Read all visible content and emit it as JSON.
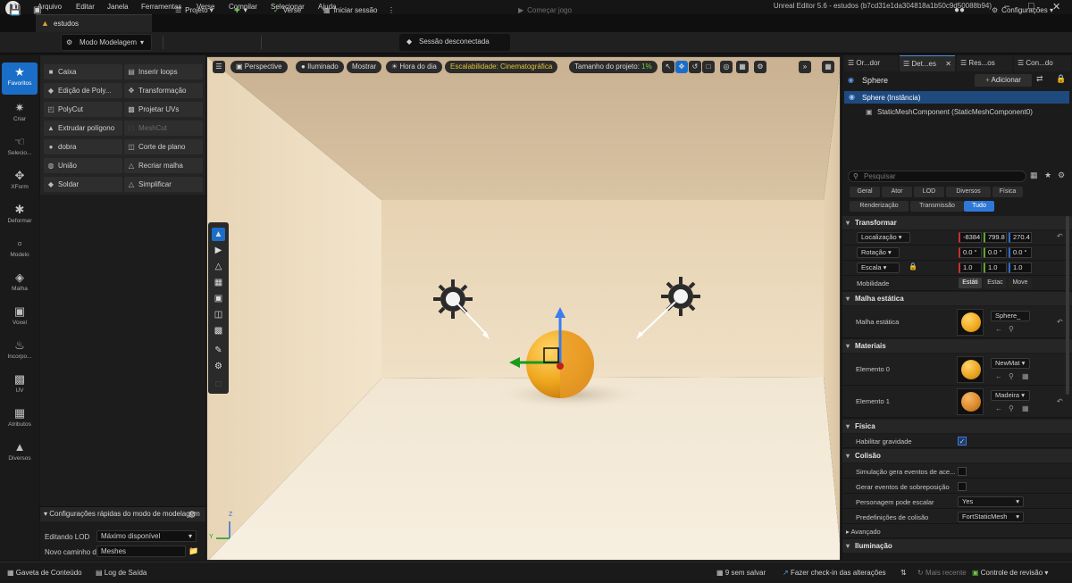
{
  "menubar": {
    "items": [
      "Arquivo",
      "Editar",
      "Janela",
      "Ferramentas",
      "Verse",
      "Compilar",
      "Selecionar",
      "Ajuda"
    ],
    "window_title": "Unreal Editor 5.6 - estudos (b7cd31e1da304818a1b50c9d50088b94)"
  },
  "doc_tab": {
    "label": "estudos"
  },
  "toolbar": {
    "mode": "Modo Modelagem",
    "projeto": "Projeto",
    "verse": "Verse",
    "iniciar_sessao": "Iniciar sessão",
    "sessao": "Sessão desconectada",
    "comecar_jogo": "Começar jogo",
    "configuracoes": "Configurações"
  },
  "left_strip": [
    {
      "label": "Favoritos",
      "icon": "star-icon"
    },
    {
      "label": "Criar",
      "icon": "create-icon"
    },
    {
      "label": "Selecio...",
      "icon": "select-icon"
    },
    {
      "label": "XForm",
      "icon": "xform-icon"
    },
    {
      "label": "Deformar",
      "icon": "deform-icon"
    },
    {
      "label": "Modelo",
      "icon": "model-icon"
    },
    {
      "label": "Malha",
      "icon": "mesh-icon"
    },
    {
      "label": "Voxel",
      "icon": "voxel-icon"
    },
    {
      "label": "Incorpo...",
      "icon": "bake-icon"
    },
    {
      "label": "UV",
      "icon": "uv-icon"
    },
    {
      "label": "Atributos",
      "icon": "attributes-icon"
    },
    {
      "label": "Diversos",
      "icon": "misc-icon"
    }
  ],
  "tools": [
    {
      "label": "Caixa",
      "enabled": true
    },
    {
      "label": "Inserir loops",
      "enabled": true
    },
    {
      "label": "Edição de Poly...",
      "enabled": true
    },
    {
      "label": "Transformação",
      "enabled": true
    },
    {
      "label": "PolyCut",
      "enabled": true
    },
    {
      "label": "Projetar UVs",
      "enabled": true
    },
    {
      "label": "Extrudar polígono",
      "enabled": true
    },
    {
      "label": "MeshCut",
      "enabled": false
    },
    {
      "label": "dobra",
      "enabled": true
    },
    {
      "label": "Corte de plano",
      "enabled": true
    },
    {
      "label": "União",
      "enabled": true
    },
    {
      "label": "Recriar malha",
      "enabled": true
    },
    {
      "label": "Soldar",
      "enabled": true
    },
    {
      "label": "Simplificar",
      "enabled": true
    }
  ],
  "quick_settings": {
    "title": "Configurações rápidas do modo de modelagem",
    "lod_label": "Editando LOD",
    "lod_value": "Máximo disponível",
    "path_label": "Novo caminho d",
    "path_value": "Meshes"
  },
  "viewport": {
    "perspective": "Perspective",
    "lit": "Iluminado",
    "show": "Mostrar",
    "time_of_day": "Hora do dia",
    "scalability": "Escalabilidade: Cinematográfica",
    "project_size_label": "Tamanho do projeto:",
    "project_size_value": "1%",
    "axis_z": "Z",
    "axis_y": "Y"
  },
  "right_panel": {
    "tabs": [
      "Or...dor",
      "Det...es",
      "Res...os",
      "Con...do"
    ],
    "actor": "Sphere",
    "add_button": "Adicionar",
    "tree": [
      "Sphere (Instância)",
      "StaticMeshComponent (StaticMeshComponent0)"
    ],
    "search_placeholder": "Pesquisar",
    "filters": [
      "Geral",
      "Ator",
      "LOD",
      "Diversos",
      "Física",
      "Renderização",
      "Transmissão",
      "Tudo"
    ],
    "transform": {
      "title": "Transformar",
      "location_label": "Localização",
      "location": [
        "-8384",
        "799.8",
        "270.4"
      ],
      "rotation_label": "Rotação",
      "rotation": [
        "0.0 °",
        "0.0 °",
        "0.0 °"
      ],
      "scale_label": "Escala",
      "scale": [
        "1.0",
        "1.0",
        "1.0"
      ],
      "mobility_label": "Mobilidade",
      "mobility": [
        "Estáti",
        "Estac",
        "Move"
      ]
    },
    "static_mesh": {
      "title": "Malha estática",
      "label": "Malha estática",
      "value": "Sphere_"
    },
    "materials": {
      "title": "Materiais",
      "items": [
        {
          "label": "Elemento 0",
          "value": "NewMat",
          "color": "#e8a21f"
        },
        {
          "label": "Elemento 1",
          "value": "Madeira",
          "color": "#d8882a"
        }
      ]
    },
    "physics": {
      "title": "Física",
      "gravity_label": "Habilitar gravidade",
      "gravity": true
    },
    "collision": {
      "title": "Colisão",
      "rows": [
        {
          "label": "Simulação gera eventos de ace..."
        },
        {
          "label": "Gerar eventos de sobreposição"
        }
      ],
      "step_label": "Personagem pode escalar",
      "step_value": "Yes",
      "preset_label": "Predefinições de colisão",
      "preset_value": "FortStaticMesh"
    },
    "advanced": "Avançado",
    "lighting": "Iluminação"
  },
  "statusbar": {
    "content_drawer": "Gaveta de Conteúdo",
    "output_log": "Log de Saída",
    "unsaved": "9 sem salvar",
    "checkin": "Fazer check-in das alterações",
    "recent": "Mais recente",
    "revision": "Controle de revisão"
  },
  "colors": {
    "accent": "#1b6ec8",
    "sphere": "#f0a81e",
    "wall": "#e9d7b8"
  }
}
